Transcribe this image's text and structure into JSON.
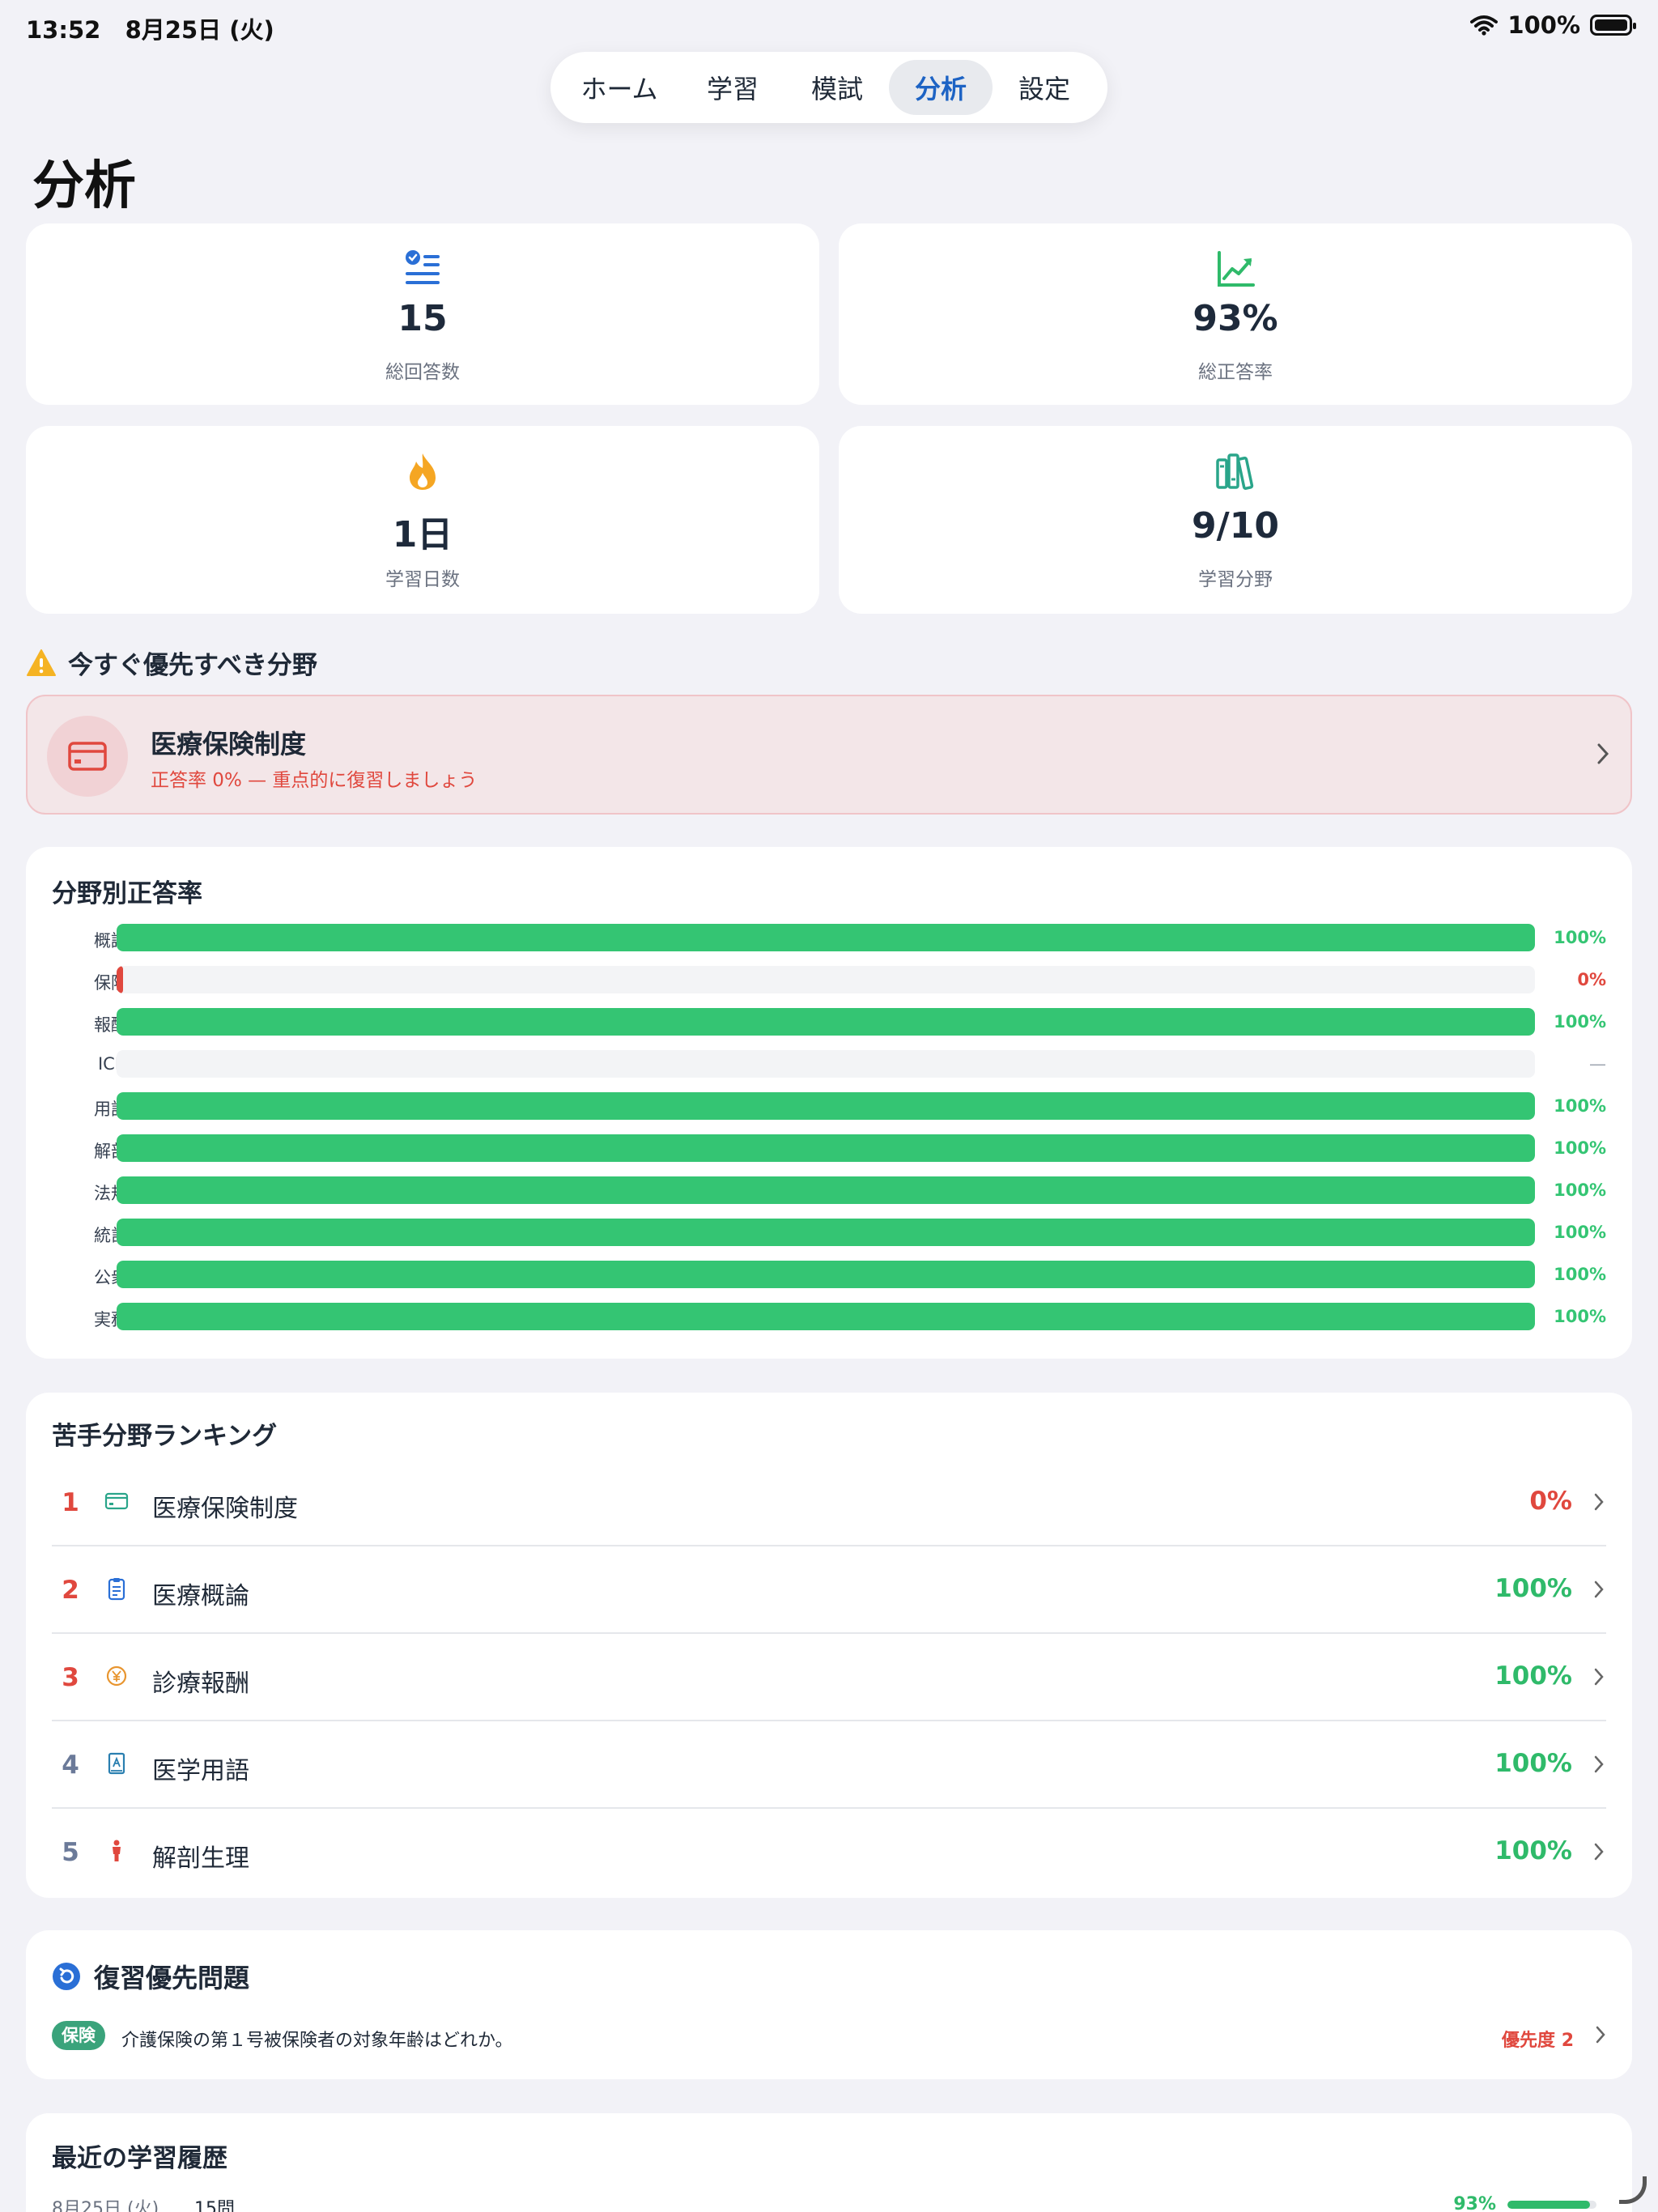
{
  "status_bar": {
    "time": "13:52",
    "date": "8月25日 (火)",
    "battery": "100%"
  },
  "tabs": [
    "ホーム",
    "学習",
    "模試",
    "分析",
    "設定"
  ],
  "selected_tab": "分析",
  "page_title": "分析",
  "stats": [
    {
      "icon": "checklist-icon",
      "value": "15",
      "label": "総回答数",
      "color": "#2a6fd6"
    },
    {
      "icon": "trend-up-icon",
      "value": "93%",
      "label": "総正答率",
      "color": "#2fba6a"
    },
    {
      "icon": "flame-icon",
      "value": "1日",
      "label": "学習日数",
      "color": "#f5a623"
    },
    {
      "icon": "books-icon",
      "value": "9/10",
      "label": "学習分野",
      "color": "#2aa58a"
    }
  ],
  "priority": {
    "heading": "今すぐ優先すべき分野",
    "title": "医療保険制度",
    "subtitle": "正答率 0% — 重点的に復習しましょう"
  },
  "accuracy_by_field": {
    "title": "分野別正答率",
    "rows": [
      {
        "label": "概論",
        "value": "100%",
        "fraction": 1.0
      },
      {
        "label": "保険",
        "value": "0%",
        "fraction": 0.0
      },
      {
        "label": "報酬",
        "value": "100%",
        "fraction": 1.0
      },
      {
        "label": "ICD",
        "value": "—",
        "fraction": null
      },
      {
        "label": "用語",
        "value": "100%",
        "fraction": 1.0
      },
      {
        "label": "解剖",
        "value": "100%",
        "fraction": 1.0
      },
      {
        "label": "法規",
        "value": "100%",
        "fraction": 1.0
      },
      {
        "label": "統計",
        "value": "100%",
        "fraction": 1.0
      },
      {
        "label": "公衆",
        "value": "100%",
        "fraction": 1.0
      },
      {
        "label": "実務",
        "value": "100%",
        "fraction": 1.0
      }
    ]
  },
  "ranking": {
    "title": "苦手分野ランキング",
    "items": [
      {
        "rank": "1",
        "icon": "credit-card-icon",
        "name": "医療保険制度",
        "rate": "0%"
      },
      {
        "rank": "2",
        "icon": "clipboard-icon",
        "name": "医療概論",
        "rate": "100%"
      },
      {
        "rank": "3",
        "icon": "yen-coin-icon",
        "name": "診療報酬",
        "rate": "100%"
      },
      {
        "rank": "4",
        "icon": "dictionary-icon",
        "name": "医学用語",
        "rate": "100%"
      },
      {
        "rank": "5",
        "icon": "person-icon",
        "name": "解剖生理",
        "rate": "100%"
      }
    ]
  },
  "review": {
    "title": "復習優先問題",
    "tag": "保険",
    "question": "介護保険の第１号被保険者の対象年齢はどれか。",
    "priority": "優先度 2"
  },
  "history": {
    "title": "最近の学習履歴",
    "date": "8月25日 (火)",
    "count": "15問",
    "rate": "93%",
    "fraction": 0.93
  },
  "colors": {
    "green": "#34c573",
    "red": "#e0483e",
    "blue": "#1d63c4",
    "gray_rank": "#6b7a99"
  }
}
